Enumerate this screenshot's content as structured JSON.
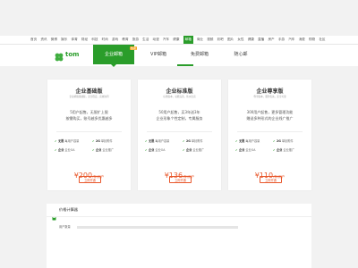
{
  "topnav": [
    "首页",
    "资讯",
    "微博",
    "娱乐",
    "体育",
    "财经",
    "科技",
    "时尚",
    "游戏",
    "教育",
    "旅游",
    "生活",
    "动漫",
    "汽车",
    "健康",
    "邮箱",
    "商业",
    "视频",
    "彩吧",
    "图片",
    "女性",
    "健康",
    "直播",
    "房产",
    "手游",
    "汽车",
    "消费",
    "购物",
    "社区"
  ],
  "topnav_active_index": 15,
  "logo": {
    "text": "tom"
  },
  "mainnav": {
    "items": [
      {
        "label": "企业邮箱",
        "active": true,
        "badge": "热卖"
      },
      {
        "label": "VIP邮箱",
        "active": false
      },
      {
        "label": "免费邮箱",
        "active": false
      },
      {
        "label": "随心邮",
        "active": false
      }
    ]
  },
  "cards": [
    {
      "title": "企业基础版",
      "subtitle": "企业邮箱基础版，安全稳定，高效协同",
      "desc": [
        "5用户起售，无限扩上限",
        "按需购买，账号越多优惠越多"
      ],
      "features": [
        [
          "无限",
          "每用户容量"
        ],
        [
          "2G",
          "单封附件"
        ],
        [
          "企业",
          "企业OA"
        ],
        [
          "企业",
          "企业推广"
        ]
      ],
      "price": "¥200",
      "unit": "/年/用户",
      "buy": "立即开通"
    },
    {
      "title": "企业标准版",
      "subtitle": "标准版本，功能完善，性价比高",
      "desc": [
        "50用户起售，买3年送3年",
        "企业形象个性定制，专属服务"
      ],
      "features": [
        [
          "无限",
          "每用户容量"
        ],
        [
          "2G",
          "单封附件"
        ],
        [
          "企业",
          "企业OA"
        ],
        [
          "企业",
          "企业推广"
        ]
      ],
      "price": "¥136",
      "unit": "/年/用户",
      "buy": "立即开通"
    },
    {
      "title": "企业尊享版",
      "subtitle": "尊享版本，服务优先，安全可靠",
      "desc": [
        "300用户起售，更多管理功能",
        "赠送多种形式的企业线广推广"
      ],
      "features": [
        [
          "无限",
          "每用户容量"
        ],
        [
          "2G",
          "单封附件"
        ],
        [
          "企业",
          "企业OA"
        ],
        [
          "企业",
          "企业推广"
        ]
      ],
      "price": "¥110",
      "unit": "/年/用户",
      "buy": "立即开通"
    }
  ],
  "calculator": {
    "title": "价格计算器",
    "row_label": "用户数量"
  },
  "colors": {
    "brand": "#2a9d2a",
    "price": "#e8562a"
  }
}
